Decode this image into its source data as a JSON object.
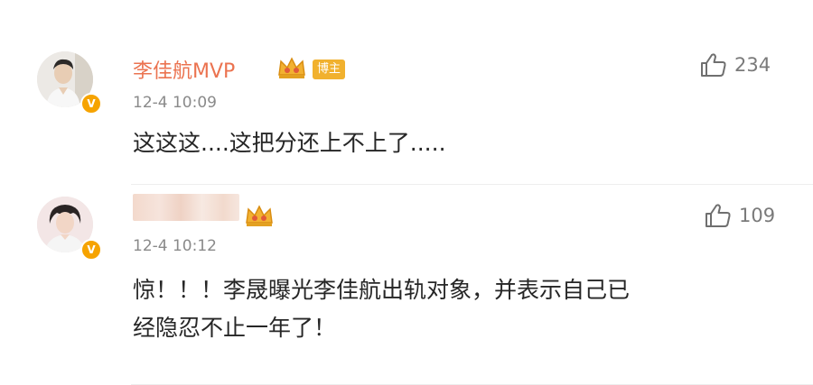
{
  "comments": [
    {
      "username": "李佳航MVP",
      "badge": "博主",
      "timestamp": "12-4 10:09",
      "text": "这这这....这把分还上不上了.....",
      "likes": "234",
      "verified": "V"
    },
    {
      "username": "",
      "timestamp": "12-4 10:12",
      "text_line1": "惊！！！李晟曝光李佳航出轨对象，并表示自己已",
      "text_line2": "经隐忍不止一年了！",
      "likes": "109",
      "verified": "V"
    }
  ],
  "icons": {
    "like": "thumbs-up-icon",
    "crown": "crown-icon",
    "verified": "verified-v-icon"
  },
  "colors": {
    "username": "#eb7350",
    "badge": "#f1b12e",
    "verified": "#f6a300",
    "timestamp": "#8a8a8a"
  }
}
